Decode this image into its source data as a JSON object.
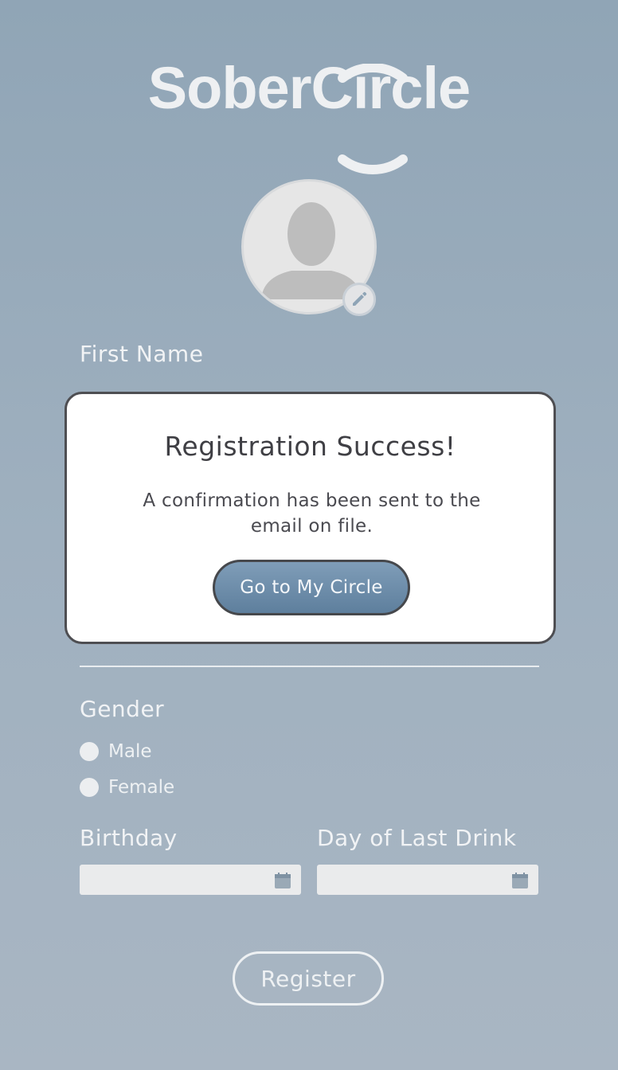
{
  "brand": {
    "name": "SoberCircle"
  },
  "form": {
    "first_name_label": "First Name",
    "gender_label": "Gender",
    "gender_options": [
      "Male",
      "Female"
    ],
    "birthday_label": "Birthday",
    "last_drink_label": "Day of Last Drink",
    "register_label": "Register"
  },
  "modal": {
    "title": "Registration Success!",
    "message": "A confirmation has been sent to the email on file.",
    "button_label": "Go to My Circle"
  },
  "icons": {
    "avatar": "person-silhouette-icon",
    "edit": "pencil-icon",
    "date": "calendar-icon"
  },
  "colors": {
    "background": "#9fb0bf",
    "modal_button": "#6a89a6",
    "modal_border": "#4e4e52"
  }
}
